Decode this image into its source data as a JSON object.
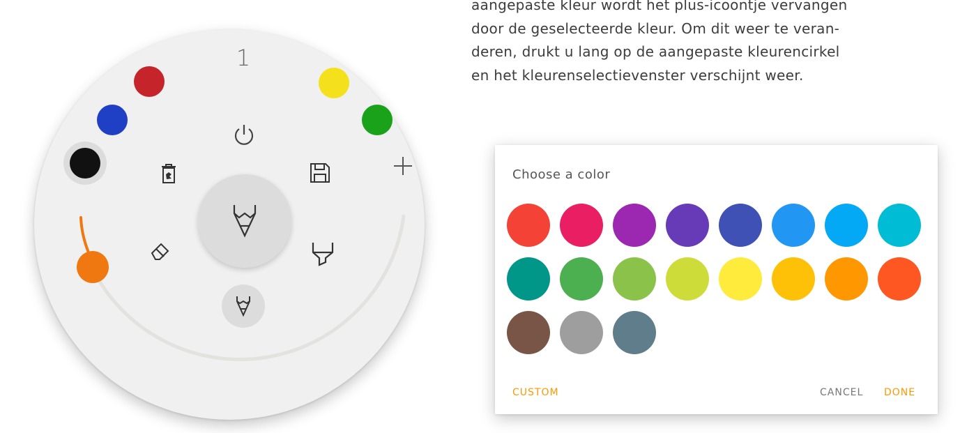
{
  "radial_menu": {
    "slot_number": "1",
    "preset_colors": [
      {
        "name": "red",
        "hex": "#c4242a"
      },
      {
        "name": "blue",
        "hex": "#1f3fc4"
      },
      {
        "name": "black",
        "hex": "#111111"
      },
      {
        "name": "yellow",
        "hex": "#f4e11c"
      },
      {
        "name": "green",
        "hex": "#1aa31a"
      }
    ],
    "selected_color": "black",
    "thickness_slider_color": "#f07810",
    "tools": [
      "power-icon",
      "trash-icon",
      "save-icon",
      "add-color-icon",
      "pen-icon",
      "eraser-icon",
      "highlighter-icon",
      "small-pen-icon"
    ]
  },
  "paragraph": {
    "lines": [
      "aangepaste kleur wordt het plus-icoontje vervangen",
      "door de geselecteerde kleur. Om dit weer te veran-",
      "deren, drukt u lang op de aangepaste kleurencirkel",
      "en het kleurenselectievenster verschijnt weer."
    ]
  },
  "color_dialog": {
    "title": "Choose a color",
    "colors": [
      "#f44336",
      "#e91e63",
      "#9c27b0",
      "#673ab7",
      "#3f51b5",
      "#2196f3",
      "#03a9f4",
      "#00bcd4",
      "#009688",
      "#4caf50",
      "#8bc34a",
      "#cddc39",
      "#ffeb3b",
      "#ffc107",
      "#ff9800",
      "#ff5722",
      "#795548",
      "#9e9e9e",
      "#607d8b"
    ],
    "accent": "#ff9800",
    "custom_label": "CUSTOM",
    "cancel_label": "CANCEL",
    "done_label": "DONE"
  }
}
